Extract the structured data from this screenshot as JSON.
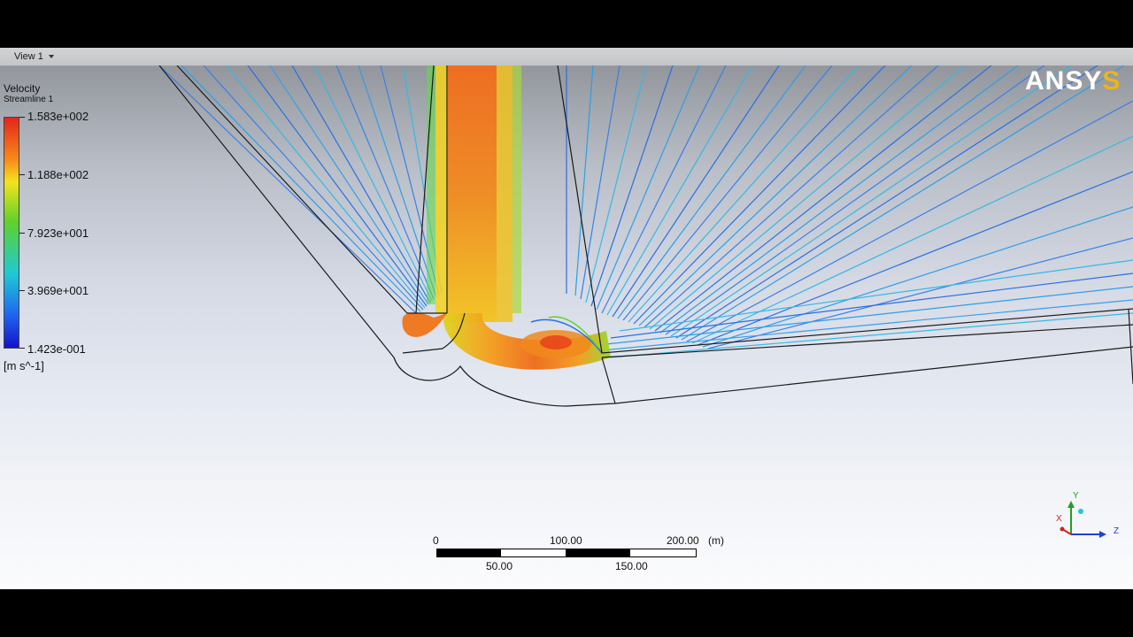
{
  "viewport": {
    "tab_label": "View 1"
  },
  "legend": {
    "variable": "Velocity",
    "object": "Streamline 1",
    "ticks": [
      "1.583e+002",
      "1.188e+002",
      "7.923e+001",
      "3.969e+001",
      "1.423e-001"
    ],
    "units": "[m s^-1]",
    "colors": [
      "#e3261a",
      "#f7891a",
      "#f3e41c",
      "#5fd22a",
      "#1ec9d6",
      "#1f64ef",
      "#1412c9"
    ]
  },
  "logo": {
    "text_main": "ANSY",
    "text_accent": "S"
  },
  "scale_bar": {
    "top_labels": [
      "0",
      "100.00",
      "200.00"
    ],
    "bottom_labels": [
      "50.00",
      "150.00"
    ],
    "unit": "(m)"
  },
  "triad": {
    "x_label": "X",
    "y_label": "Y",
    "z_label": "Z",
    "x_color": "#d02020",
    "y_color": "#20a020",
    "z_color": "#2040d0"
  }
}
